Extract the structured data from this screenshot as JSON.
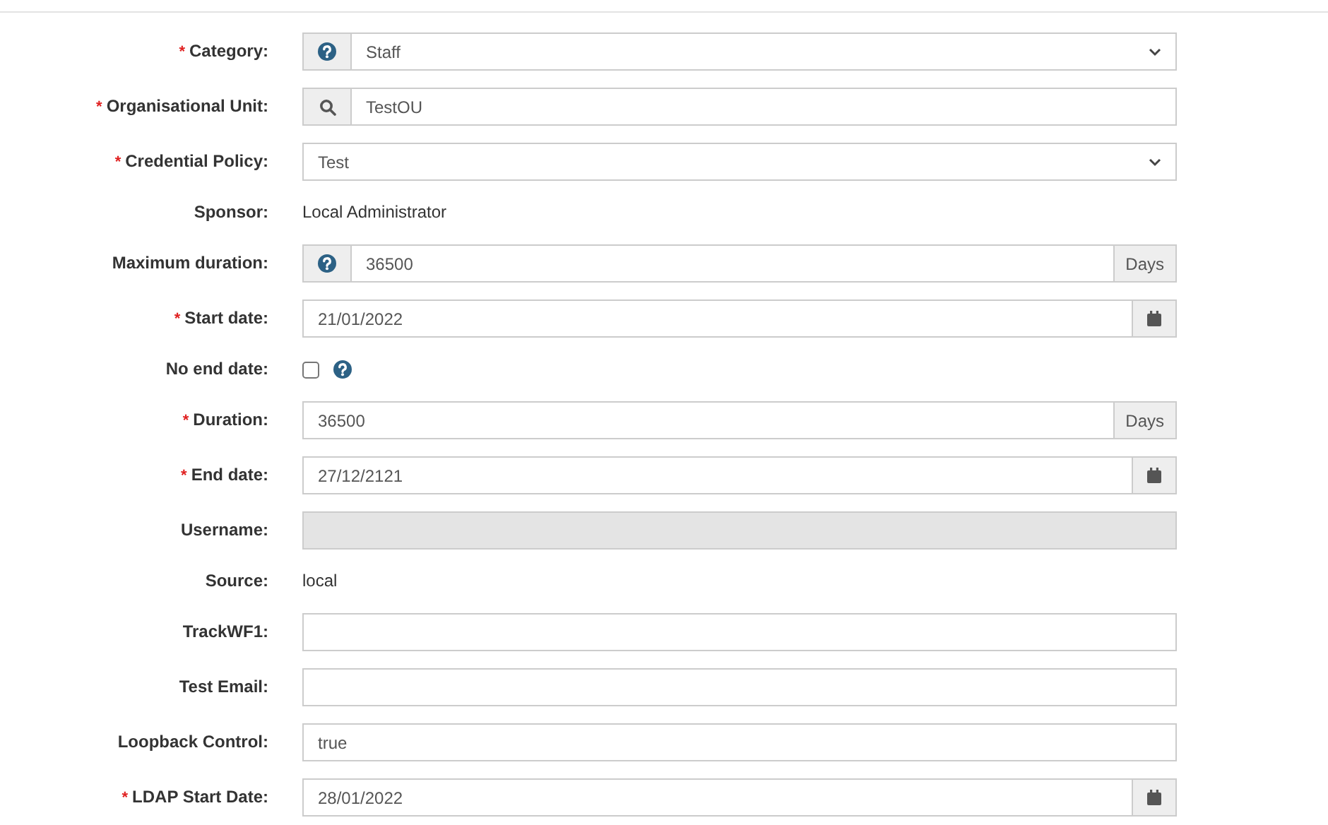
{
  "required_marker": "*",
  "fields": [
    {
      "kind": "select",
      "label": "Category:",
      "required": true,
      "prefix": {
        "kind": "help"
      },
      "value": "Staff",
      "disabled": false
    },
    {
      "kind": "input",
      "label": "Organisational Unit:",
      "required": true,
      "prefix": {
        "kind": "search"
      },
      "value": "TestOU",
      "disabled": false
    },
    {
      "kind": "select",
      "label": "Credential Policy:",
      "required": true,
      "value": "Test",
      "disabled": false
    },
    {
      "kind": "text",
      "label": "Sponsor:",
      "required": false,
      "value": "Local Administrator"
    },
    {
      "kind": "input",
      "label": "Maximum duration:",
      "required": false,
      "prefix": {
        "kind": "help"
      },
      "value": "36500",
      "suffix": {
        "kind": "unit",
        "label": "Days"
      },
      "disabled": false
    },
    {
      "kind": "input",
      "label": "Start date:",
      "required": true,
      "value": "21/01/2022",
      "suffix": {
        "kind": "calendar"
      },
      "disabled": false
    },
    {
      "kind": "checkbox",
      "label": "No end date:",
      "required": false,
      "checked": false,
      "suffix": {
        "kind": "help"
      }
    },
    {
      "kind": "input",
      "label": "Duration:",
      "required": true,
      "value": "36500",
      "suffix": {
        "kind": "unit",
        "label": "Days"
      },
      "disabled": false
    },
    {
      "kind": "input",
      "label": "End date:",
      "required": true,
      "value": "27/12/2121",
      "suffix": {
        "kind": "calendar"
      },
      "disabled": false
    },
    {
      "kind": "input",
      "label": "Username:",
      "required": false,
      "disabled": true
    },
    {
      "kind": "text",
      "label": "Source:",
      "required": false,
      "value": "local"
    },
    {
      "kind": "input",
      "label": "TrackWF1:",
      "required": false,
      "disabled": false
    },
    {
      "kind": "input",
      "label": "Test Email:",
      "required": false,
      "disabled": false
    },
    {
      "kind": "input",
      "label": "Loopback Control:",
      "required": false,
      "value": "true",
      "disabled": false
    },
    {
      "kind": "input",
      "label": "LDAP Start Date:",
      "required": true,
      "value": "28/01/2022",
      "suffix": {
        "kind": "calendar"
      },
      "disabled": false
    }
  ]
}
